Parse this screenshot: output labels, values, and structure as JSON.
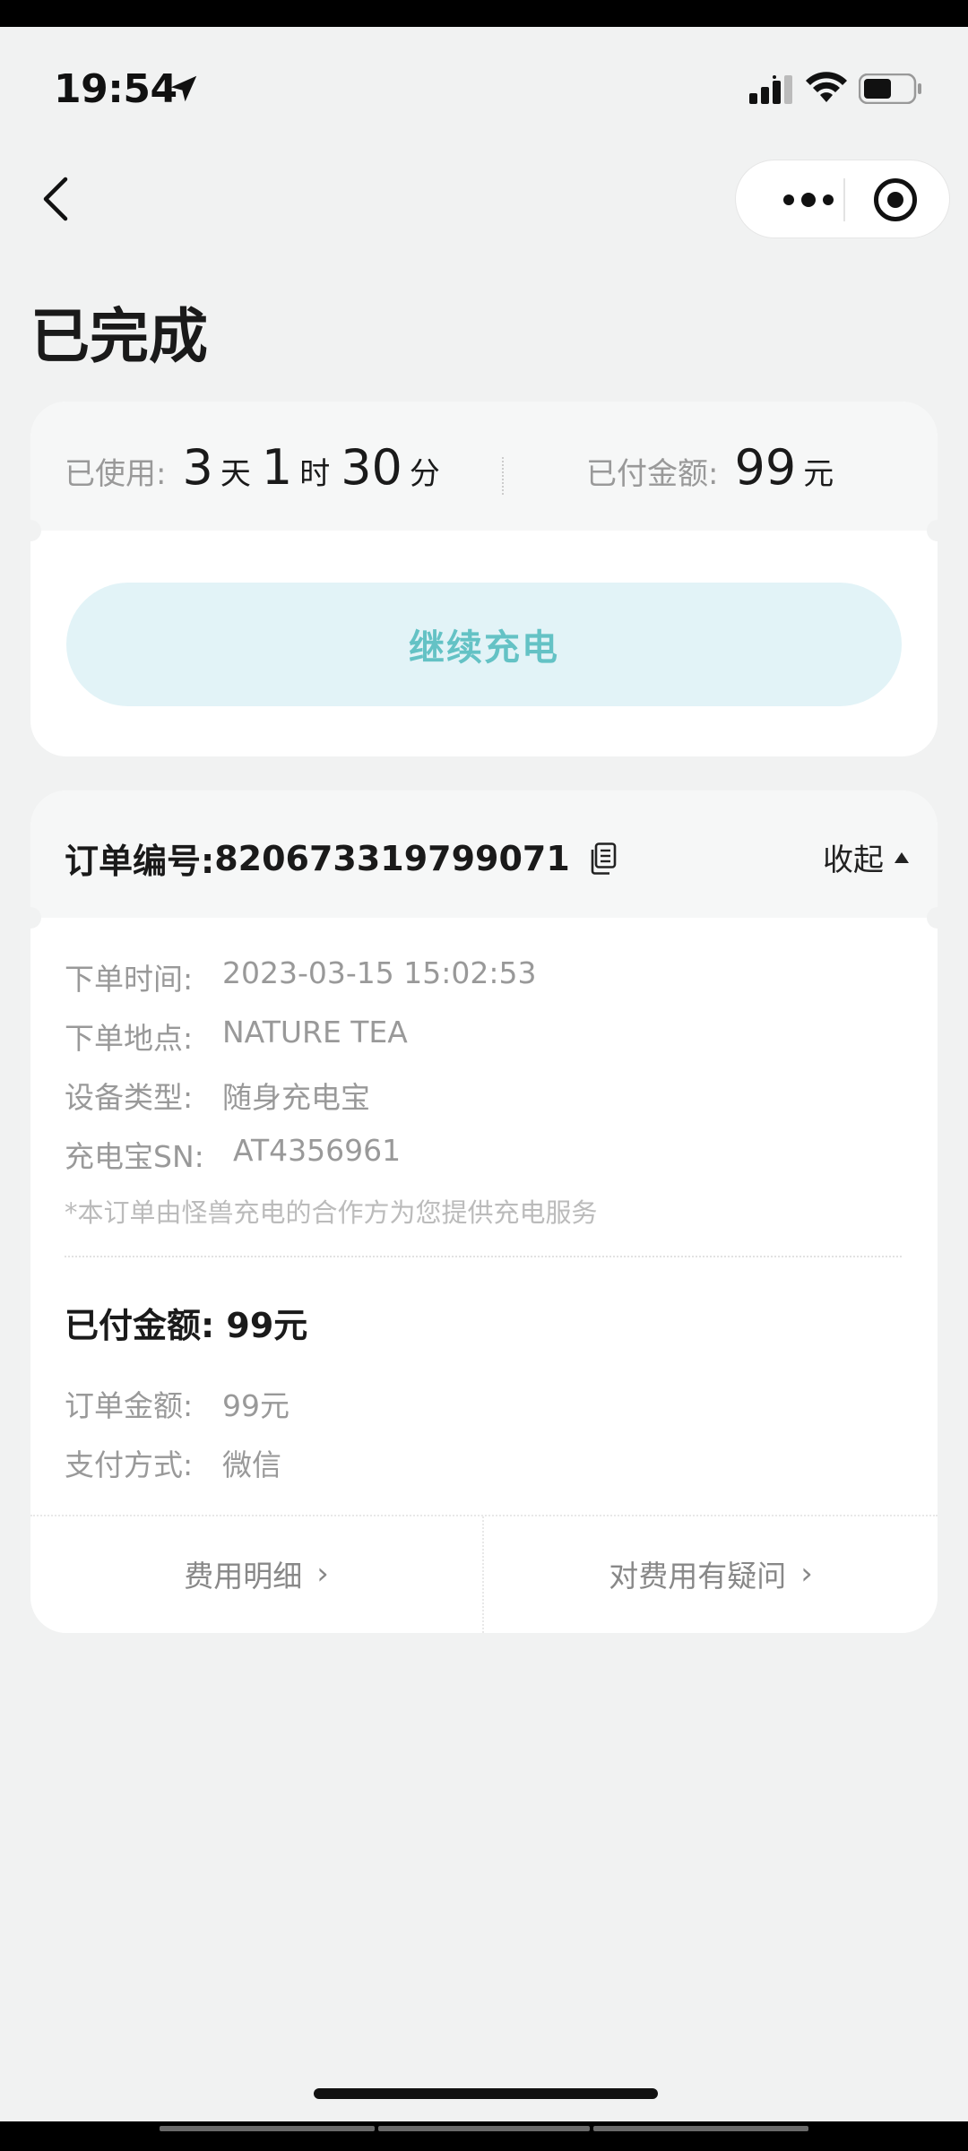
{
  "status_bar": {
    "time": "19:54"
  },
  "nav": {
    "title": "已完成"
  },
  "usage": {
    "used_label": "已使用:",
    "days": "3",
    "days_unit": "天",
    "hours": "1",
    "hours_unit": "时",
    "minutes": "30",
    "minutes_unit": "分",
    "paid_label": "已付金额:",
    "paid_amount": "99",
    "paid_unit": "元"
  },
  "continue_button": "继续充电",
  "order": {
    "number_label": "订单编号:",
    "number": "820673319799071",
    "collapse_label": "收起",
    "rows": [
      {
        "key": "下单时间:",
        "value": "2023-03-15 15:02:53"
      },
      {
        "key": "下单地点:",
        "value": "NATURE TEA"
      },
      {
        "key": "设备类型:",
        "value": "随身充电宝"
      },
      {
        "key": "充电宝SN:",
        "value": "AT4356961"
      }
    ],
    "note": "*本订单由怪兽充电的合作方为您提供充电服务",
    "paid_title": "已付金额: 99元",
    "payment_rows": [
      {
        "key": "订单金额:",
        "value": "99元"
      },
      {
        "key": "支付方式:",
        "value": "微信"
      }
    ],
    "fee_detail_link": "费用明细",
    "fee_question_link": "对费用有疑问"
  },
  "colors": {
    "accent_text": "#64c2c5",
    "accent_bg": "#e2f3f7",
    "background": "#f1f2f2"
  }
}
